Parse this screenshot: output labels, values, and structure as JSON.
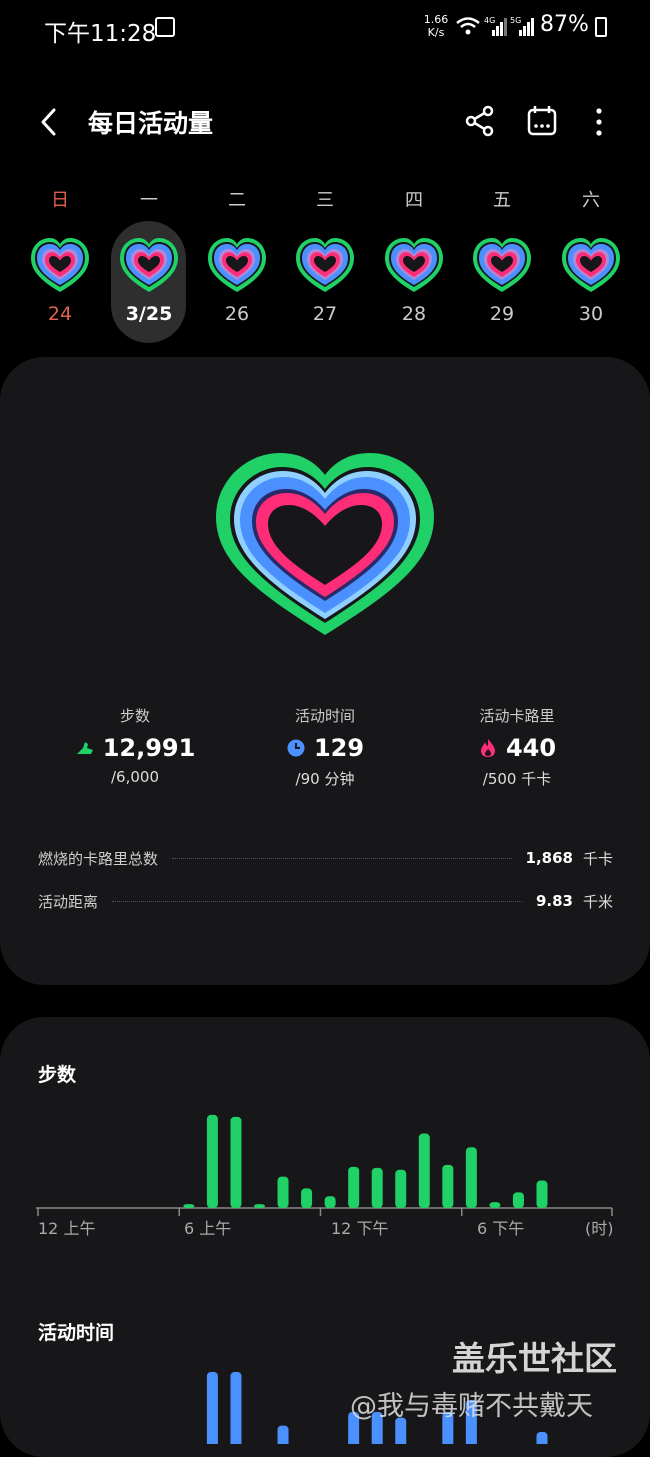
{
  "status_bar": {
    "time": "下午11:28",
    "speed_value": "1.66",
    "speed_unit": "K/s",
    "net_4g": "4G",
    "net_5g": "5G",
    "battery": "87%"
  },
  "header": {
    "title": "每日活动量",
    "icons": [
      "back-arrow-icon",
      "share-icon",
      "calendar-icon",
      "more-vert-icon"
    ]
  },
  "week": {
    "days": [
      {
        "weekday": "日",
        "date": "24"
      },
      {
        "weekday": "一",
        "date": "3/25"
      },
      {
        "weekday": "二",
        "date": "26"
      },
      {
        "weekday": "三",
        "date": "27"
      },
      {
        "weekday": "四",
        "date": "28"
      },
      {
        "weekday": "五",
        "date": "29"
      },
      {
        "weekday": "六",
        "date": "30"
      }
    ],
    "selected_index": 1
  },
  "summary": {
    "steps": {
      "label": "步数",
      "value": "12,991",
      "goal": "/6,000"
    },
    "active_time": {
      "label": "活动时间",
      "value": "129",
      "goal": "/90 分钟"
    },
    "active_cal": {
      "label": "活动卡路里",
      "value": "440",
      "goal": "/500 千卡"
    },
    "total_burned": {
      "label": "燃烧的卡路里总数",
      "value": "1,868",
      "unit": "千卡"
    },
    "distance": {
      "label": "活动距离",
      "value": "9.83",
      "unit": "千米"
    }
  },
  "colors": {
    "steps_ring": "#1fd166",
    "time_ring": "#4a90ff",
    "cal_ring": "#ff2d78",
    "background": "#000000",
    "card": "#17171a"
  },
  "steps_chart": {
    "title": "步数",
    "x_labels": [
      "12 上午",
      "6 上午",
      "12 下午",
      "6 下午",
      "(时)"
    ]
  },
  "active_time_chart": {
    "title": "活动时间"
  },
  "chart_data": [
    {
      "type": "bar",
      "title": "步数",
      "categories": [
        "0",
        "1",
        "2",
        "3",
        "4",
        "5",
        "6",
        "7",
        "8",
        "9",
        "10",
        "11",
        "12",
        "13",
        "14",
        "15",
        "16",
        "17",
        "18",
        "19",
        "20",
        "21",
        "22",
        "23"
      ],
      "values": [
        0,
        0,
        0,
        0,
        0,
        0,
        0.04,
        0.95,
        0.93,
        0.04,
        0.32,
        0.2,
        0.12,
        0.42,
        0.41,
        0.39,
        0.76,
        0.44,
        0.62,
        0.06,
        0.16,
        0.28,
        0,
        0
      ],
      "xlabel": "(时)",
      "tick_labels": [
        "12 上午",
        "6 上午",
        "12 下午",
        "6 下午"
      ],
      "color": "#1fd166"
    }
  ],
  "watermark": {
    "line1": "盖乐世社区",
    "line2": "@我与毒赌不共戴天"
  }
}
